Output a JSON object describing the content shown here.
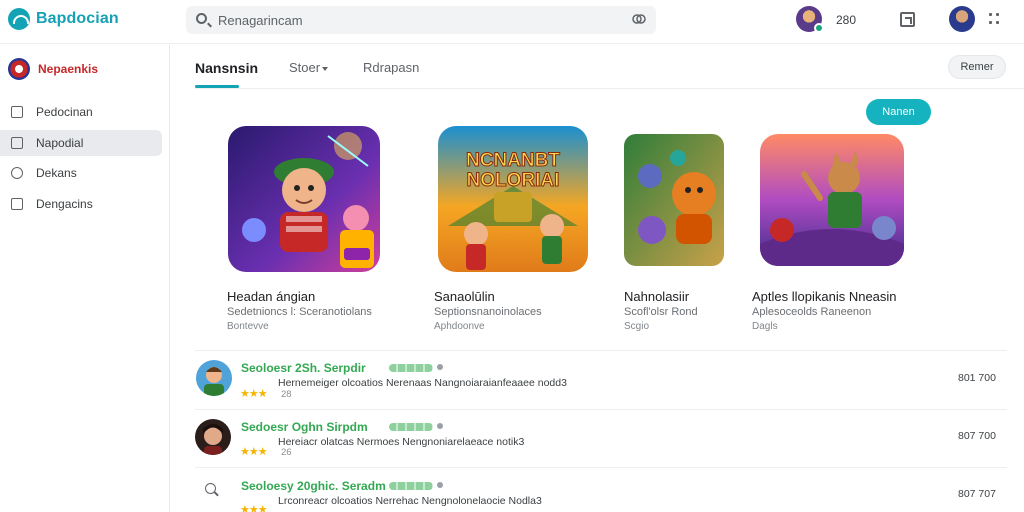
{
  "app": {
    "name": "Bapdocian",
    "logo_icon": "cloud-logo-icon"
  },
  "search": {
    "placeholder": "Renagarincam",
    "icon": "search-icon",
    "mic_icon": "voice-search-icon"
  },
  "topbar": {
    "count": "280",
    "icons": [
      "profile-avatar-icon",
      "open-window-icon",
      "user-avatar-icon",
      "apps-grid-icon"
    ]
  },
  "sidebar": {
    "brand": "Nepaenkis",
    "items": [
      {
        "label": "Pedocinan",
        "icon": "calendar-icon",
        "active": false
      },
      {
        "label": "Napodial",
        "icon": "bag-icon",
        "active": true
      },
      {
        "label": "Dekans",
        "icon": "compass-icon",
        "active": false
      },
      {
        "label": "Dengacins",
        "icon": "square-icon",
        "active": false
      }
    ]
  },
  "tabs": [
    {
      "label": "Nansnsin",
      "active": true
    },
    {
      "label": "Stoer",
      "active": false,
      "has_caret": true
    },
    {
      "label": "Rdrapasn",
      "active": false
    }
  ],
  "buttons": {
    "more": "Remer",
    "primary": "Nanen"
  },
  "featured": [
    {
      "title": "Headan ángian",
      "subtitle": "Sedetnioncs l: Sceranotiolans",
      "meta": "Bontevve"
    },
    {
      "title": "Sanaolūlin",
      "subtitle": "Septionsnanoinolaces",
      "meta": "Aphdoonve",
      "art_text": [
        "NCNANBT",
        "NOLORIAI"
      ]
    },
    {
      "title": "Nahnolasiir",
      "subtitle": "Scofl'olsr Rond",
      "meta": "Scgio"
    },
    {
      "title": "Aptles llopikanis Nneasin",
      "subtitle": "Aplesoceolds Raneenon",
      "meta": "Dagls"
    }
  ],
  "list": [
    {
      "title": "Seoloesr 2Sh. Serpdir",
      "description": "Hernemeiger olcoatios Nerenaas Nangnoiaraianfeaaee nodd3",
      "stars": "★★★",
      "sub": "28",
      "price": "801 700",
      "avatar": "boy-avatar-icon"
    },
    {
      "title": "Sedoesr Oghn Sirpdm",
      "description": "Hereiacr olatcas Nermoes Nengnoniarelaeace notik3",
      "stars": "★★★",
      "sub": "26",
      "price": "807 700",
      "avatar": "dark-hair-avatar-icon"
    },
    {
      "title": "Seoloesy 20ghic. Seradm",
      "description": "Lrconreacr olcoatios Nerrehac Nengnolonelaocie Nodla3",
      "stars": "★★★",
      "sub": "",
      "price": "807 707",
      "avatar": "search-icon"
    }
  ],
  "colors": {
    "accent": "#14a3b5",
    "button": "#15b3bf",
    "title_green": "#34a853",
    "star": "#f4b400",
    "brand_red": "#c62828"
  }
}
